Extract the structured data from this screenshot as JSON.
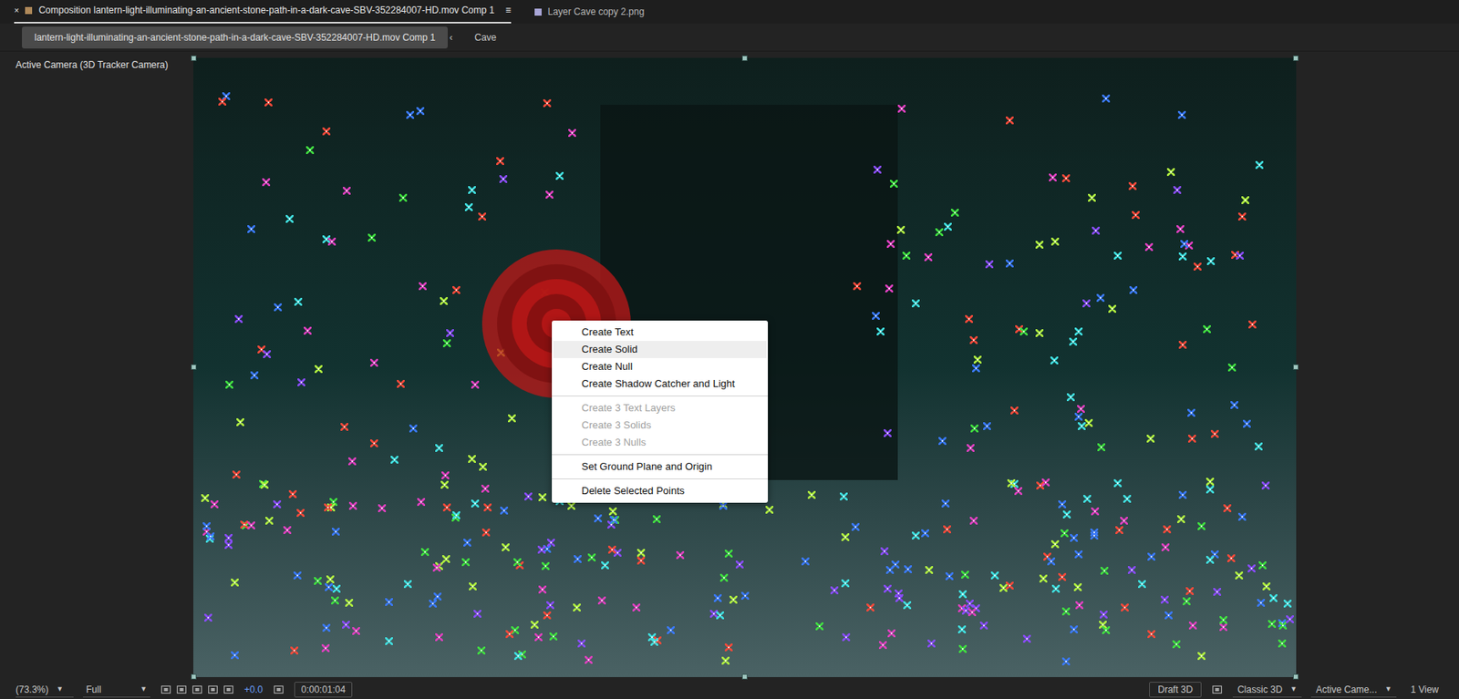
{
  "tabs": [
    {
      "close": "×",
      "label": "Composition lantern-light-illuminating-an-ancient-stone-path-in-a-dark-cave-SBV-352284007-HD.mov Comp 1",
      "menu": "≡",
      "selected": true
    },
    {
      "close": "",
      "label": "Layer Cave copy 2.png",
      "menu": "",
      "selected": false
    }
  ],
  "breadcrumbs": [
    {
      "label": "lantern-light-illuminating-an-ancient-stone-path-in-a-dark-cave-SBV-352284007-HD.mov Comp 1",
      "selected": true
    },
    {
      "label": "Cave",
      "selected": false
    }
  ],
  "breadcrumb_separator": "‹",
  "viewer": {
    "label": "Active Camera (3D Tracker Camera)"
  },
  "context_menu": {
    "groups": [
      [
        {
          "label": "Create Text",
          "highlighted": false,
          "disabled": false
        },
        {
          "label": "Create Solid",
          "highlighted": true,
          "disabled": false
        },
        {
          "label": "Create Null",
          "highlighted": false,
          "disabled": false
        },
        {
          "label": "Create Shadow Catcher and Light",
          "highlighted": false,
          "disabled": false
        }
      ],
      [
        {
          "label": "Create 3 Text Layers",
          "highlighted": false,
          "disabled": true
        },
        {
          "label": "Create 3 Solids",
          "highlighted": false,
          "disabled": true
        },
        {
          "label": "Create 3 Nulls",
          "highlighted": false,
          "disabled": true
        }
      ],
      [
        {
          "label": "Set Ground Plane and Origin",
          "highlighted": false,
          "disabled": false
        }
      ],
      [
        {
          "label": "Delete Selected Points",
          "highlighted": false,
          "disabled": false
        }
      ]
    ]
  },
  "status_bar": {
    "zoom": "(73.3%)",
    "resolution": "Full",
    "exposure": "+0.0",
    "timecode": "0:00:01:04",
    "renderer_button": "Draft 3D",
    "renderer": "Classic 3D",
    "view": "Active Came...",
    "layout": "1 View"
  }
}
